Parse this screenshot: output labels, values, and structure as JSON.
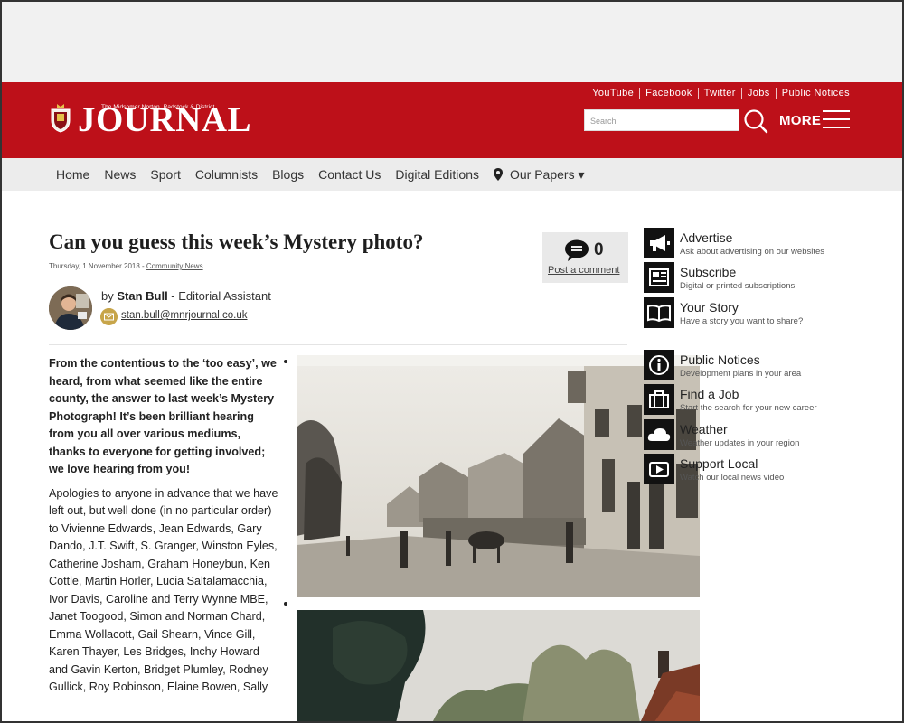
{
  "header": {
    "masthead_tagline": "The Midsomer Norton, Radstock & District",
    "masthead_name": "JOURNAL",
    "top_links": [
      "YouTube",
      "Facebook",
      "Twitter",
      "Jobs",
      "Public Notices"
    ],
    "search_placeholder": "Search",
    "more_label": "MORE",
    "brand_color": "#bd1019"
  },
  "nav": {
    "items": [
      "Home",
      "News",
      "Sport",
      "Columnists",
      "Blogs",
      "Contact Us",
      "Digital Editions",
      "Our Papers ▾"
    ]
  },
  "article": {
    "title": "Can you guess this week’s Mystery photo?",
    "date": "Thursday, 1 November 2018",
    "date_separator": " - ",
    "category": "Community News",
    "comment_count": "0",
    "comment_link": "Post a comment",
    "author_prefix": "by ",
    "author_name": "Stan Bull",
    "author_role": " - Editorial Assistant",
    "author_email": "stan.bull@mnrjournal.co.uk",
    "lead_paragraph": "From the contentious to the ‘too easy’, we heard, from what seemed like the entire county, the answer to last week’s Mystery Photograph! It’s been brilliant hearing from you all over various mediums, thanks to everyone for getting involved; we love hearing from you!",
    "body_paragraph": "Apologies to anyone in advance that we have left out, but well done (in no particular order) to Vivienne Edwards, Jean Edwards, Gary Dando, J.T. Swift, S. Granger, Winston Eyles, Catherine Josham, Graham Honeybun, Ken Cottle, Martin Horler, Lucia Saltalamacchia, Ivor Davis, Caroline and Terry Wynne MBE, Janet Toogood, Simon and Norman Chard, Emma Wollacott, Gail Shearn, Vince Gill, Karen Thayer, Les Bridges, Inchy Howard and Gavin Kerton, Bridget Plumley, Rodney Gullick, Roy Robinson, Elaine Bowen, Sally"
  },
  "sidebar": {
    "items": [
      {
        "title": "Advertise",
        "subtitle": "Ask about advertising on our websites",
        "icon": "megaphone-icon"
      },
      {
        "title": "Subscribe",
        "subtitle": "Digital or printed subscriptions",
        "icon": "newspaper-icon"
      },
      {
        "title": "Your Story",
        "subtitle": "Have a story you want to share?",
        "icon": "book-icon"
      },
      {
        "title": "Public Notices",
        "subtitle": "Development plans in your area",
        "icon": "info-icon"
      },
      {
        "title": "Find a Job",
        "subtitle": "Start the search for your new career",
        "icon": "briefcase-icon"
      },
      {
        "title": "Weather",
        "subtitle": "Weather updates in your region",
        "icon": "cloud-icon"
      },
      {
        "title": "Support Local",
        "subtitle": "Watch our local news video",
        "icon": "video-icon"
      }
    ]
  }
}
